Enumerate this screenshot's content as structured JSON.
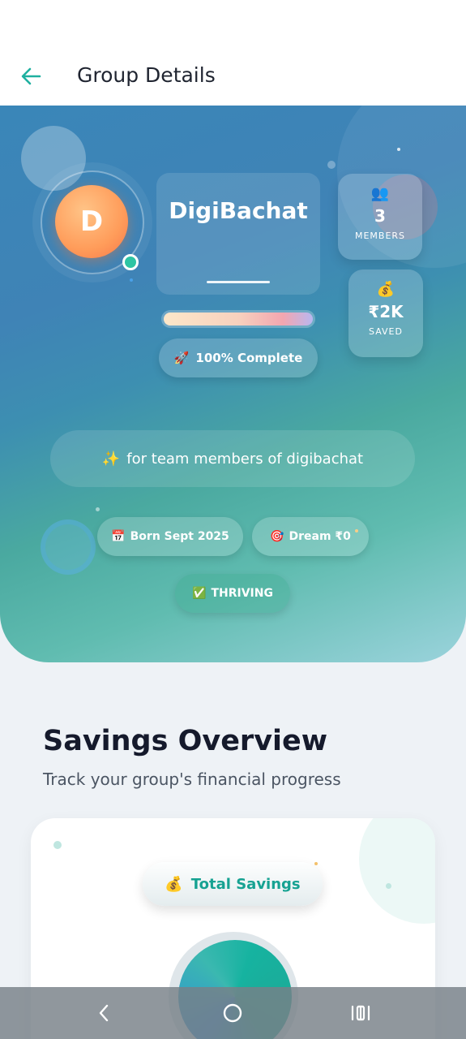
{
  "appbar": {
    "title": "Group Details"
  },
  "group": {
    "avatar_letter": "D",
    "name": "DigiBachat",
    "progress_percent": 100,
    "progress_label": "100% Complete",
    "members_value": "3",
    "members_label": "MEMBERS",
    "saved_value": "₹2K",
    "saved_label": "SAVED",
    "tagline": "for team members of digibachat",
    "born_label": "Born Sept 2025",
    "dream_label": "Dream ₹0",
    "status_label": "THRIVING"
  },
  "savings": {
    "title": "Savings Overview",
    "subtitle": "Track your group's financial progress",
    "total_label": "Total Savings"
  },
  "icons": {
    "rocket": "🚀",
    "members": "👥",
    "money_bag": "💰",
    "sparkles": "✨",
    "calendar": "📅",
    "target": "🎯",
    "check": "✅"
  },
  "colors": {
    "accent": "#16a292",
    "online": "#2ec4a3"
  }
}
